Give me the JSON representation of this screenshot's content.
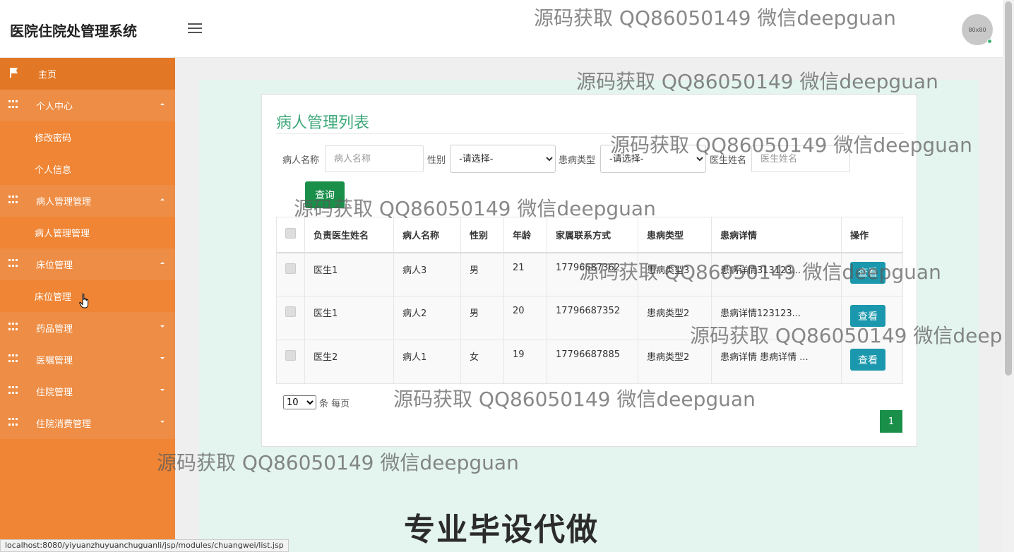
{
  "header": {
    "app_title": "医院住院处管理系统",
    "avatar_text": "80x80"
  },
  "sidebar": {
    "home": "主页",
    "groups": [
      {
        "label": "个人中心",
        "items": [
          "修改密码",
          "个人信息"
        ]
      },
      {
        "label": "病人管理管理",
        "items": [
          "病人管理管理"
        ]
      },
      {
        "label": "床位管理",
        "items": [
          "床位管理"
        ]
      },
      {
        "label": "药品管理",
        "items": []
      },
      {
        "label": "医嘱管理",
        "items": []
      },
      {
        "label": "住院管理",
        "items": []
      },
      {
        "label": "住院消费管理",
        "items": []
      }
    ]
  },
  "page": {
    "title": "病人管理列表",
    "filters": {
      "patient_name_label": "病人名称",
      "patient_name_placeholder": "病人名称",
      "gender_label": "性别",
      "gender_value": "-请选择-",
      "disease_type_label": "患病类型",
      "disease_type_value": "-请选择-",
      "doctor_name_label": "医生姓名",
      "doctor_name_placeholder": "医生姓名",
      "query_button": "查询"
    },
    "table": {
      "columns": [
        "负责医生姓名",
        "病人名称",
        "性别",
        "年龄",
        "家属联系方式",
        "患病类型",
        "患病详情",
        "操作"
      ],
      "rows": [
        {
          "doctor": "医生1",
          "patient": "病人3",
          "gender": "男",
          "age": "21",
          "contact": "17796687362",
          "disease_type": "患病类型3",
          "detail": "患病详情313123...",
          "action": "查看"
        },
        {
          "doctor": "医生1",
          "patient": "病人2",
          "gender": "男",
          "age": "20",
          "contact": "17796687352",
          "disease_type": "患病类型2",
          "detail": "患病详情123123...",
          "action": "查看"
        },
        {
          "doctor": "医生2",
          "patient": "病人1",
          "gender": "女",
          "age": "19",
          "contact": "17796687885",
          "disease_type": "患病类型2",
          "detail": "患病详情 患病详情 ...",
          "action": "查看"
        }
      ]
    },
    "pagination": {
      "page_size": "10",
      "page_size_suffix": "条 每页",
      "current_page": "1"
    }
  },
  "watermarks": {
    "contact": "源码获取 QQ86050149 微信deepguan",
    "contact_cut": "源码获取 QQ86050149 微信deep",
    "bottom": "专业毕设代做"
  },
  "statusbar": {
    "url": "localhost:8080/yiyuanzhuyuanchuguanli/jsp/modules/chuangwei/list.jsp"
  },
  "colors": {
    "sidebar": "#ef8535",
    "sidebar_parent": "#ee8d45",
    "accent_green": "#1a8f4a",
    "title_green": "#3da87a",
    "view_button": "#1b98ad"
  }
}
